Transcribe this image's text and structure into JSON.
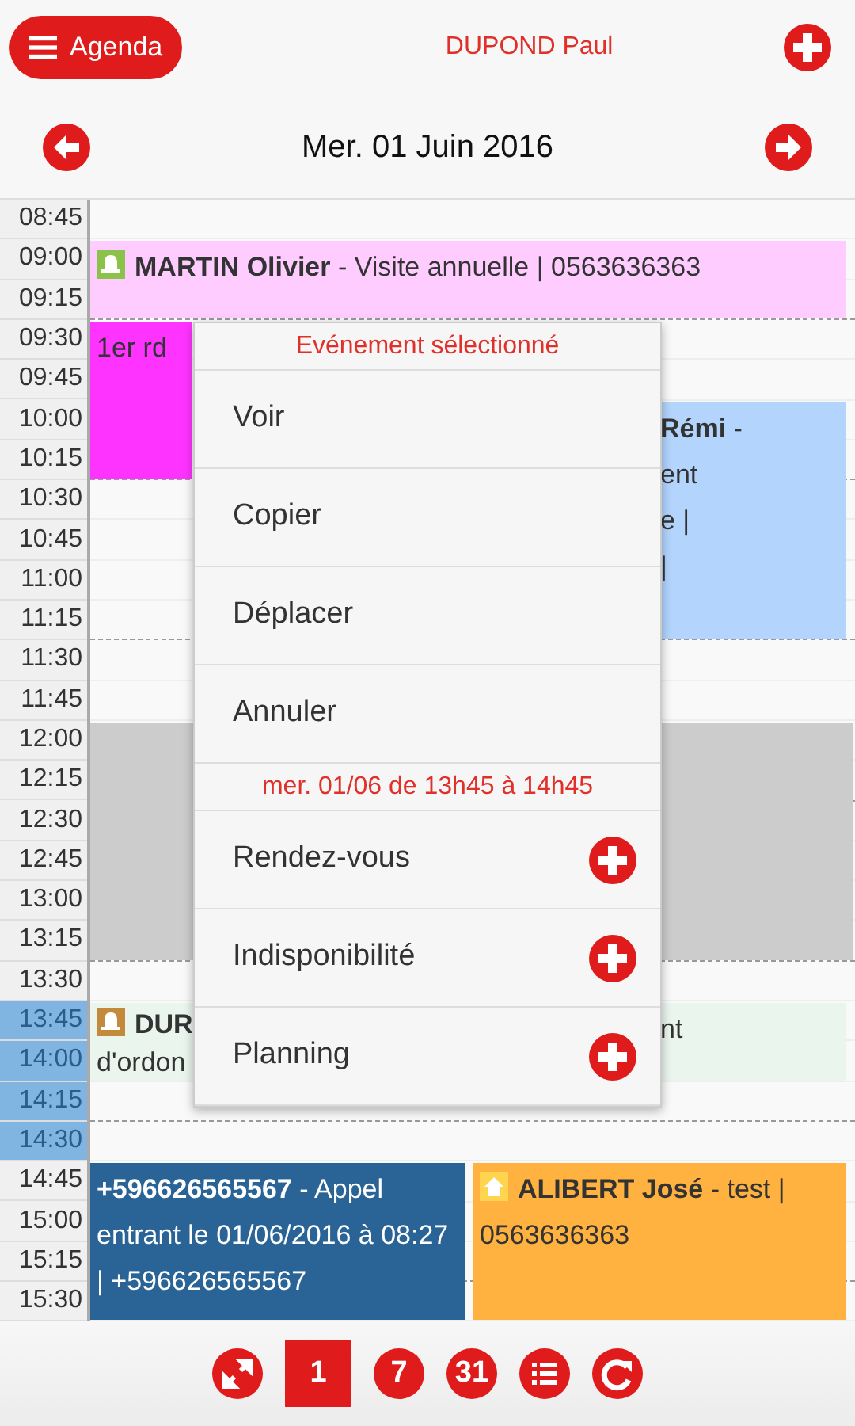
{
  "header": {
    "menu_button": "Agenda",
    "user": "DUPOND Paul"
  },
  "date_bar": {
    "date": "Mer. 01 Juin 2016"
  },
  "time_slots": [
    {
      "time": "08:45",
      "selected": false
    },
    {
      "time": "09:00",
      "selected": false
    },
    {
      "time": "09:15",
      "selected": false
    },
    {
      "time": "09:30",
      "selected": false
    },
    {
      "time": "09:45",
      "selected": false
    },
    {
      "time": "10:00",
      "selected": false
    },
    {
      "time": "10:15",
      "selected": false
    },
    {
      "time": "10:30",
      "selected": false
    },
    {
      "time": "10:45",
      "selected": false
    },
    {
      "time": "11:00",
      "selected": false
    },
    {
      "time": "11:15",
      "selected": false
    },
    {
      "time": "11:30",
      "selected": false
    },
    {
      "time": "11:45",
      "selected": false
    },
    {
      "time": "12:00",
      "selected": false
    },
    {
      "time": "12:15",
      "selected": false
    },
    {
      "time": "12:30",
      "selected": false
    },
    {
      "time": "12:45",
      "selected": false
    },
    {
      "time": "13:00",
      "selected": false
    },
    {
      "time": "13:15",
      "selected": false
    },
    {
      "time": "13:30",
      "selected": false
    },
    {
      "time": "13:45",
      "selected": true
    },
    {
      "time": "14:00",
      "selected": true
    },
    {
      "time": "14:15",
      "selected": true
    },
    {
      "time": "14:30",
      "selected": true
    },
    {
      "time": "14:45",
      "selected": false
    },
    {
      "time": "15:00",
      "selected": false
    },
    {
      "time": "15:15",
      "selected": false
    },
    {
      "time": "15:30",
      "selected": false
    }
  ],
  "events": [
    {
      "kind": "reminder",
      "color": "#ffccff",
      "lines": [
        "**MARTIN Olivier** - Visite annuelle | 0563636363"
      ]
    },
    {
      "kind": "appointment",
      "color": "#ff33ff",
      "lines": [
        "1er rd"
      ]
    },
    {
      "kind": "appointment",
      "color": "#b3d4fc",
      "lines": [
        "**Rémi** -",
        "ent",
        "e |",
        "|"
      ]
    },
    {
      "kind": "unavailable",
      "color": "#cccccc"
    },
    {
      "kind": "reminder_past",
      "color": "#eaf5ee",
      "lines": [
        "**DUR**",
        "d'ordon"
      ],
      "side_text": "nt"
    },
    {
      "kind": "appointment",
      "color": "#2a6496",
      "lines": [
        "**+596626565567** - Appel entrant le 01/06/2016 à 08:27 | +596626565567"
      ]
    },
    {
      "kind": "home",
      "color": "#ffb23f",
      "lines": [
        "**ALIBERT José** - test |",
        "0563636363"
      ]
    }
  ],
  "context_menu": {
    "title": "Evénement sélectionné",
    "actions": [
      "Voir",
      "Copier",
      "Déplacer",
      "Annuler"
    ],
    "slot_title": "mer. 01/06 de 13h45 à 14h45",
    "create_actions": [
      "Rendez-vous",
      "Indisponibilité",
      "Planning"
    ]
  },
  "toolbar": [
    {
      "kind": "expand",
      "selected": false
    },
    {
      "kind": "day",
      "label": "1",
      "selected": true
    },
    {
      "kind": "week",
      "label": "7",
      "selected": false
    },
    {
      "kind": "month",
      "label": "31",
      "selected": false
    },
    {
      "kind": "list",
      "selected": false
    },
    {
      "kind": "refresh",
      "selected": false
    }
  ]
}
